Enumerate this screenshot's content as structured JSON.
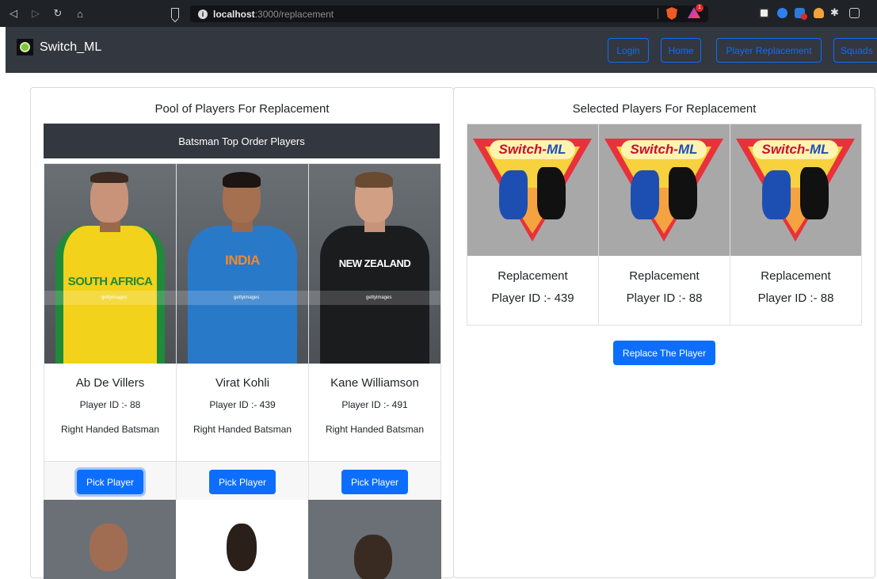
{
  "browser": {
    "url_host": "localhost",
    "url_path": ":3000/replacement",
    "rewards_badge": "1"
  },
  "navbar": {
    "brand": "Switch_ML",
    "links": [
      "Login",
      "Home",
      "Player Replacement",
      "Squads"
    ]
  },
  "pool": {
    "title": "Pool of Players For Replacement",
    "category": "Batsman Top Order Players",
    "players": [
      {
        "name": "Ab De Villers",
        "id_text": "Player ID :- 88",
        "role": "Right Handed Batsman",
        "jersey_text": "SOUTH AFRICA",
        "button": "Pick Player"
      },
      {
        "name": "Virat Kohli",
        "id_text": "Player ID :- 439",
        "role": "Right Handed Batsman",
        "jersey_text": "INDIA",
        "button": "Pick Player"
      },
      {
        "name": "Kane Williamson",
        "id_text": "Player ID :- 491",
        "role": "Right Handed Batsman",
        "jersey_text": "NEW ZEALAND",
        "button": "Pick Player"
      }
    ],
    "watermark": "gettyimages"
  },
  "selected": {
    "title": "Selected Players For Replacement",
    "logo_text_a": "Switch-",
    "logo_text_b": "ML",
    "slots": [
      {
        "label": "Replacement",
        "id_text": "Player ID :- 439"
      },
      {
        "label": "Replacement",
        "id_text": "Player ID :- 88"
      },
      {
        "label": "Replacement",
        "id_text": "Player ID :- 88"
      }
    ],
    "replace_button": "Replace The Player"
  },
  "colors": {
    "navbar": "#33373f",
    "primary": "#0d6efd",
    "sa_jersey": "#f2d21b",
    "india_jersey": "#2979c9",
    "nz_jersey": "#1b1c1e"
  }
}
